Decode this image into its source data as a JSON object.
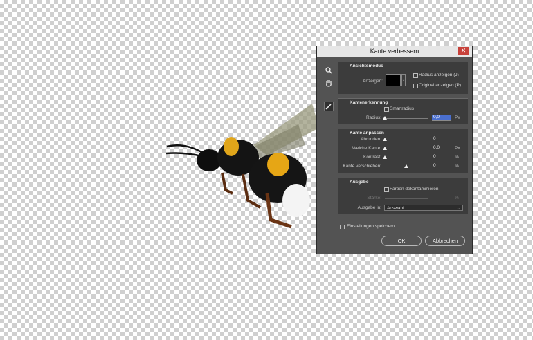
{
  "dialog": {
    "title": "Kante verbessern",
    "close_glyph": "✕"
  },
  "tools": [
    "zoom-icon",
    "hand-icon",
    "refine-radius-brush-icon"
  ],
  "view_mode": {
    "title": "Ansichtsmodus",
    "show_label": "Anzeigen:",
    "radius_show": "Radius anzeigen (J)",
    "original_show": "Original anzeigen (P)"
  },
  "edge_detection": {
    "title": "Kantenerkennung",
    "smart_radius": "Smartradius",
    "radius_label": "Radius:",
    "radius_value": "0,0",
    "radius_unit": "Px"
  },
  "adjust_edge": {
    "title": "Kante anpassen",
    "rows": [
      {
        "label": "Abrunden:",
        "value": "0",
        "unit": ""
      },
      {
        "label": "Weiche Kante:",
        "value": "0,0",
        "unit": "Px"
      },
      {
        "label": "Kontrast:",
        "value": "0",
        "unit": "%"
      },
      {
        "label": "Kante verschieben:",
        "value": "0",
        "unit": "%"
      }
    ]
  },
  "output": {
    "title": "Ausgabe",
    "decontaminate": "Farben dekontaminieren",
    "amount_label": "Stärke:",
    "amount_unit": "%",
    "output_to_label": "Ausgabe in:",
    "output_to_value": "Auswahl"
  },
  "remember": "Einstellungen speichern",
  "buttons": {
    "ok": "OK",
    "cancel": "Abbrechen"
  }
}
